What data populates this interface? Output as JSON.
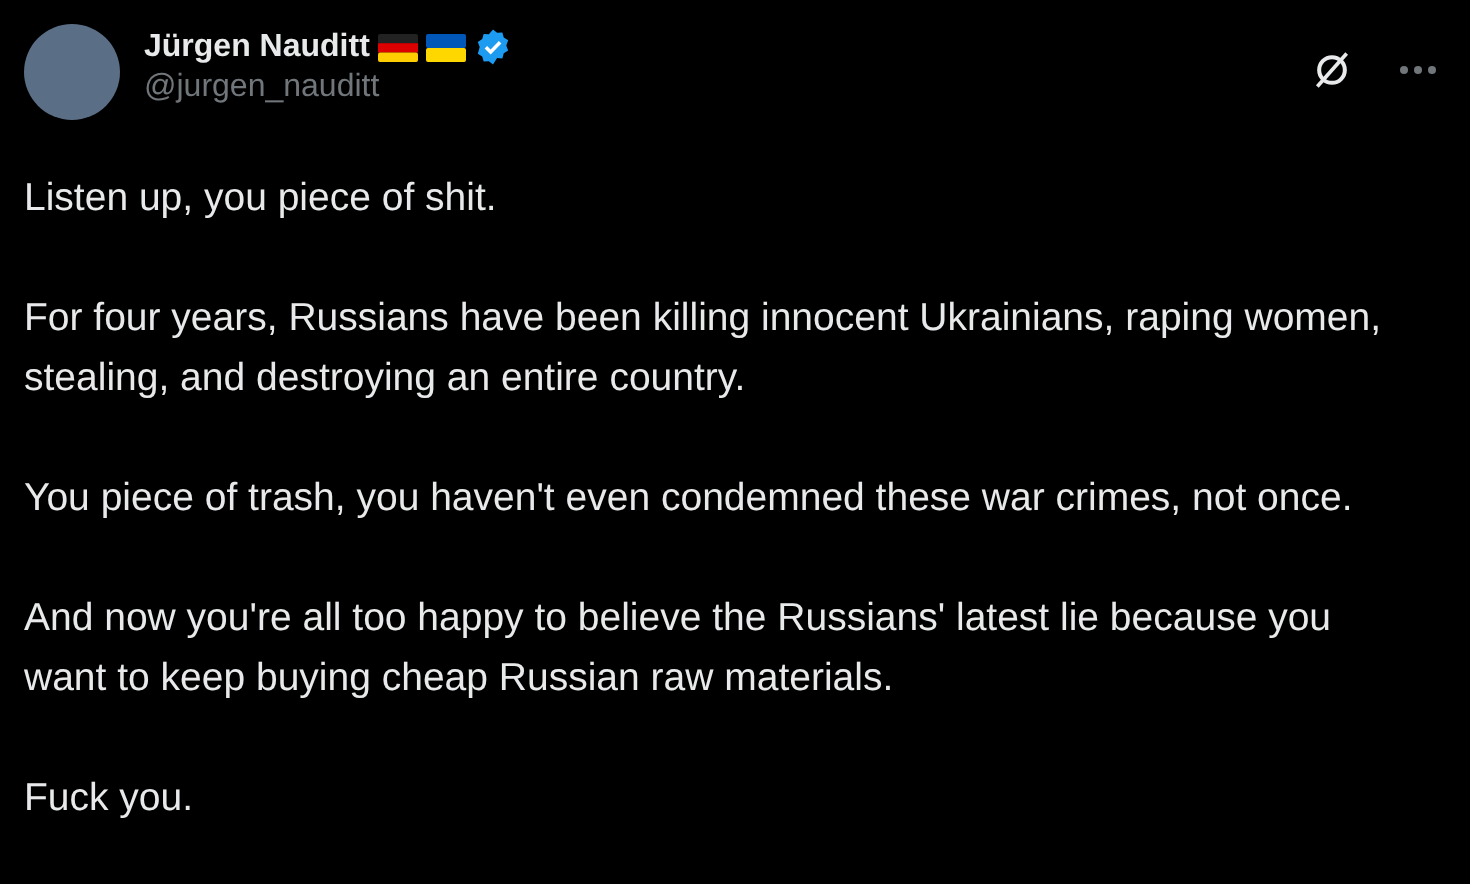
{
  "author": {
    "name": "Jürgen Nauditt",
    "handle": "@jurgen_nauditt",
    "verified": true
  },
  "paragraphs": [
    "Listen up, you piece of shit.",
    "For four years, Russians have been killing innocent Ukrainians, raping women, stealing, and destroying an entire country.",
    "You piece of trash, you haven't even condemned these war crimes, not once.",
    "And now you're all too happy to believe the Russians' latest lie because you want to keep buying cheap Russian raw materials.",
    "Fuck you."
  ]
}
